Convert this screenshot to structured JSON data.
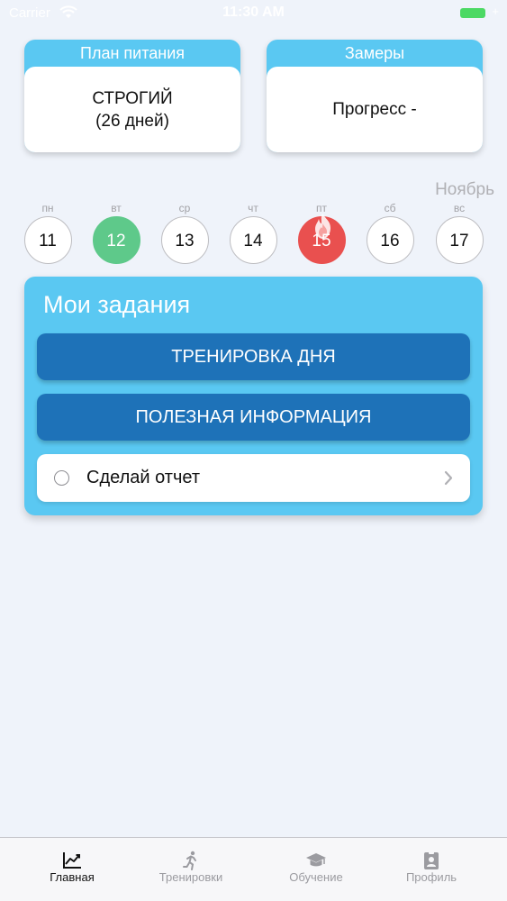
{
  "status_bar": {
    "carrier": "Carrier",
    "time": "11:30 AM"
  },
  "cards": {
    "meal_plan": {
      "title": "План питания",
      "line1": "СТРОГИЙ",
      "line2": "(26 дней)"
    },
    "measurements": {
      "title": "Замеры",
      "value": "Прогресс -"
    }
  },
  "calendar": {
    "month": "Ноябрь",
    "days": [
      {
        "label": "пн",
        "num": "11",
        "state": "default"
      },
      {
        "label": "вт",
        "num": "12",
        "state": "today"
      },
      {
        "label": "ср",
        "num": "13",
        "state": "default"
      },
      {
        "label": "чт",
        "num": "14",
        "state": "default"
      },
      {
        "label": "пт",
        "num": "15",
        "state": "streak-fire"
      },
      {
        "label": "сб",
        "num": "16",
        "state": "default"
      },
      {
        "label": "вс",
        "num": "17",
        "state": "default"
      }
    ]
  },
  "tasks": {
    "title": "Мои задания",
    "workout_button": "ТРЕНИРОВКА ДНЯ",
    "info_button": "ПОЛЕЗНАЯ ИНФОРМАЦИЯ",
    "report_label": "Сделай отчет"
  },
  "tab_bar": {
    "tabs": [
      {
        "label": "Главная",
        "icon": "chart-line-icon",
        "active": true
      },
      {
        "label": "Тренировки",
        "icon": "running-person-icon",
        "active": false
      },
      {
        "label": "Обучение",
        "icon": "graduation-cap-icon",
        "active": false
      },
      {
        "label": "Профиль",
        "icon": "id-badge-icon",
        "active": false
      }
    ]
  },
  "colors": {
    "accent": "#5ac8f2",
    "button": "#1e72b8",
    "today": "#5ec98a",
    "fire": "#e9504f",
    "background": "#eff3fa"
  }
}
